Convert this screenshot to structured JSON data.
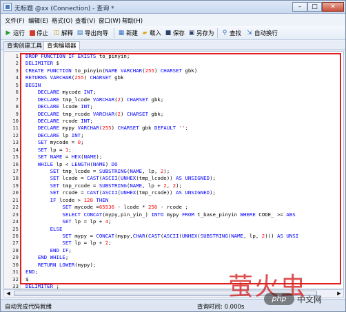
{
  "window": {
    "title": "无标题 @xx (Connection) - 查询 *",
    "min_glyph": "–",
    "max_glyph": "□",
    "close_glyph": "✕"
  },
  "menu": [
    "文件(F)",
    "编辑(E)",
    "格式(O)",
    "查看(V)",
    "窗口(W)",
    "帮助(H)"
  ],
  "toolbar": {
    "run": "运行",
    "stop": "停止",
    "explain": "解释",
    "export": "导出向导",
    "new": "新建",
    "load": "载入",
    "save": "保存",
    "save_as": "另存为",
    "find": "查找",
    "autowrap": "自动换行"
  },
  "tabs": [
    "查询创建工具",
    "查询编辑器"
  ],
  "editor": {
    "lines": [
      "DROP FUNCTION IF EXISTS to_pinyin;",
      "DELIMITER $",
      "CREATE FUNCTION to_pinyin(NAME VARCHAR(255) CHARSET gbk)",
      "RETURNS VARCHAR(255) CHARSET gbk",
      "BEGIN",
      "    DECLARE mycode INT;",
      "    DECLARE tmp_lcode VARCHAR(2) CHARSET gbk;",
      "    DECLARE lcode INT;",
      "    DECLARE tmp_rcode VARCHAR(2) CHARSET gbk;",
      "    DECLARE rcode INT;",
      "    DECLARE mypy VARCHAR(255) CHARSET gbk DEFAULT '';",
      "    DECLARE lp INT;",
      "    SET mycode = 0;",
      "    SET lp = 1;",
      "    SET NAME = HEX(NAME);",
      "    WHILE lp < LENGTH(NAME) DO",
      "        SET tmp_lcode = SUBSTRING(NAME, lp, 2);",
      "        SET lcode = CAST(ASCII(UNHEX(tmp_lcode)) AS UNSIGNED);",
      "        SET tmp_rcode = SUBSTRING(NAME, lp + 2, 2);",
      "        SET rcode = CAST(ASCII(UNHEX(tmp_rcode)) AS UNSIGNED);",
      "        IF lcode > 128 THEN",
      "            SET mycode =65536 - lcode * 256 - rcode ;",
      "            SELECT CONCAT(mypy,pin_yin_) INTO mypy FROM t_base_pinyin WHERE CODE_ >= ABS",
      "            SET lp = lp + 4;",
      "        ELSE",
      "            SET mypy = CONCAT(mypy,CHAR(CAST(ASCII(UNHEX(SUBSTRING(NAME, lp, 2))) AS UNSI",
      "            SET lp = lp + 2;",
      "        END IF;",
      "    END WHILE;",
      "    RETURN LOWER(mypy);",
      "END;",
      "$",
      "DELIMITER ;"
    ]
  },
  "status": {
    "left": "自动完成代码就绪",
    "query_time": "查询时间: 0.000s"
  },
  "watermark": {
    "chars": "萤火虫",
    "badge": "php",
    "sub": "中文网"
  },
  "colors": {
    "keyword": "#0000ff",
    "string": "#a31515",
    "number": "#ff0000",
    "highlight_box": "#e02020"
  }
}
